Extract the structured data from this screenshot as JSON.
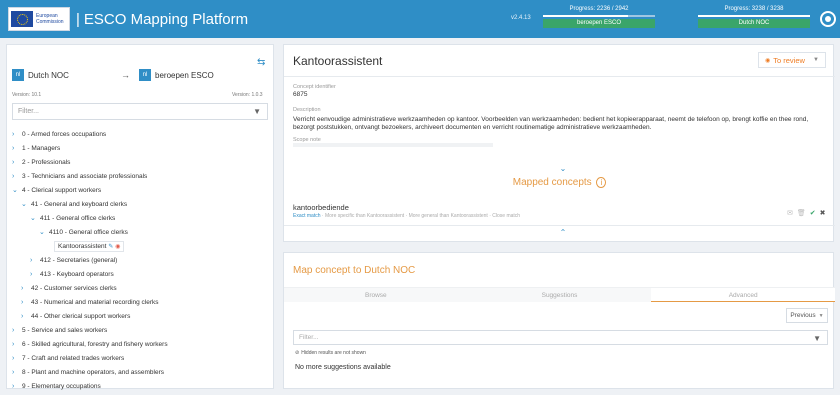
{
  "header": {
    "eu_logo_text": [
      "European",
      "Commission"
    ],
    "separator": "|",
    "app_title": "ESCO Mapping Platform",
    "version": "v2.4.13",
    "progress": [
      {
        "text": "Progress: 2236 / 2942",
        "label": "beroepen ESCO",
        "fraction": 0.76
      },
      {
        "text": "Progress: 3238 / 3238",
        "label": "Dutch NOC",
        "fraction": 1.0
      }
    ]
  },
  "left": {
    "source": {
      "flag": "nl",
      "name": "Dutch NOC",
      "version": "Version: 10.1"
    },
    "target": {
      "flag": "nl",
      "name": "beroepen ESCO",
      "version": "Version: 1.0.3"
    },
    "filter_placeholder": "Filter...",
    "tree": [
      {
        "label": "0 - Armed forces occupations",
        "level": 0,
        "expanded": false
      },
      {
        "label": "1 - Managers",
        "level": 0,
        "expanded": false
      },
      {
        "label": "2 - Professionals",
        "level": 0,
        "expanded": false
      },
      {
        "label": "3 - Technicians and associate professionals",
        "level": 0,
        "expanded": false
      },
      {
        "label": "4 - Clerical support workers",
        "level": 0,
        "expanded": true
      },
      {
        "label": "41 - General and keyboard clerks",
        "level": 1,
        "expanded": true
      },
      {
        "label": "411 - General office clerks",
        "level": 2,
        "expanded": true
      },
      {
        "label": "4110 - General office clerks",
        "level": 3,
        "expanded": true
      },
      {
        "label": "Kantoorassistent",
        "level": 4,
        "expanded": null,
        "selected": true
      },
      {
        "label": "412 - Secretaries (general)",
        "level": 2,
        "expanded": false
      },
      {
        "label": "413 - Keyboard operators",
        "level": 2,
        "expanded": false
      },
      {
        "label": "42 - Customer services clerks",
        "level": 1,
        "expanded": false
      },
      {
        "label": "43 - Numerical and material recording clerks",
        "level": 1,
        "expanded": false
      },
      {
        "label": "44 - Other clerical support workers",
        "level": 1,
        "expanded": false
      },
      {
        "label": "5 - Service and sales workers",
        "level": 0,
        "expanded": false
      },
      {
        "label": "6 - Skilled agricultural, forestry and fishery workers",
        "level": 0,
        "expanded": false
      },
      {
        "label": "7 - Craft and related trades workers",
        "level": 0,
        "expanded": false
      },
      {
        "label": "8 - Plant and machine operators, and assemblers",
        "level": 0,
        "expanded": false
      },
      {
        "label": "9 - Elementary occupations",
        "level": 0,
        "expanded": false
      }
    ]
  },
  "concept": {
    "title": "Kantoorassistent",
    "review_label": "To review",
    "identifier_label": "Concept identifier",
    "identifier_value": "6875",
    "description_label": "Description",
    "description": "Verricht eenvoudige administratieve werkzaamheden op kantoor. Voorbeelden van werkzaamheden: bedient het kopieerapparaat, neemt de telefoon op, brengt koffie en thee rond, bezorgt poststukken, ontvangt bezoekers, archiveert documenten en verricht routinematige administratieve werkzaamheden.",
    "scope_label": "Scope note"
  },
  "mapped": {
    "title": "Mapped concepts",
    "items": [
      {
        "name": "kantoorbediende",
        "exact": "Exact match",
        "other": " · More specific than Kantoorassistent · More general than Kantoorassistent · Close match"
      }
    ]
  },
  "map_panel": {
    "title": "Map concept to Dutch NOC",
    "tabs": [
      "Browse",
      "Suggestions",
      "Advanced"
    ],
    "active_tab": 2,
    "previous_label": "Previous",
    "filter_placeholder": "Filter...",
    "hidden_note": "Hidden results are not shown",
    "no_more": "No more suggestions available"
  },
  "colors": {
    "header": "#2f8ec6",
    "accent_orange": "#e59a45",
    "review_orange": "#ef7d24",
    "progress_green": "#3aa56a"
  }
}
